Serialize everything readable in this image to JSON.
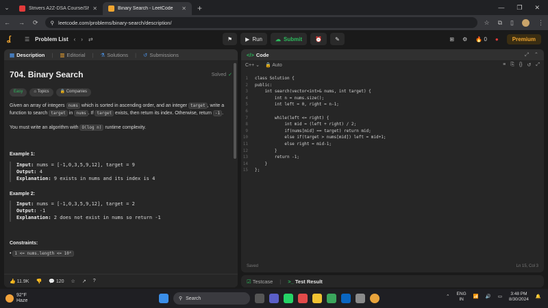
{
  "browser": {
    "tabs": [
      {
        "title": "Strivers A2Z-DSA Course/Sheet",
        "color": "#e23a3a",
        "active": false
      },
      {
        "title": "Binary Search - LeetCode",
        "color": "#f0a530",
        "active": true
      }
    ],
    "url": "leetcode.com/problems/binary-search/description/"
  },
  "header": {
    "problem_list": "Problem List",
    "run": "Run",
    "submit": "Submit",
    "streak": "0",
    "premium": "Premium"
  },
  "left": {
    "tabs": [
      "Description",
      "Editorial",
      "Solutions",
      "Submissions"
    ],
    "title": "704. Binary Search",
    "status": "Solved",
    "chips": [
      "Easy",
      "Topics",
      "Companies"
    ],
    "desc1_a": "Given an array of integers ",
    "desc1_nums": "nums",
    "desc1_b": " which is sorted in ascending order, and an integer ",
    "desc1_target": "target",
    "desc1_c": ", write a function to search ",
    "desc1_target2": "target",
    "desc1_d": " in ",
    "desc1_nums2": "nums",
    "desc1_e": ". If ",
    "desc1_target3": "target",
    "desc1_f": " exists, then return its index. Otherwise, return ",
    "desc1_neg": "-1",
    "desc1_g": ".",
    "desc2_a": "You must write an algorithm with ",
    "desc2_code": "O(log n)",
    "desc2_b": " runtime complexity.",
    "examples": [
      {
        "heading": "Example 1:",
        "input": "nums = [-1,0,3,5,9,12], target = 9",
        "output": "4",
        "explanation": "9 exists in nums and its index is 4"
      },
      {
        "heading": "Example 2:",
        "input": "nums = [-1,0,3,5,9,12], target = 2",
        "output": "-1",
        "explanation": "2 does not exist in nums so return -1"
      }
    ],
    "labels": {
      "input": "Input:",
      "output": "Output:",
      "explanation": "Explanation:"
    },
    "constraints_heading": "Constraints:",
    "constraint1": "1 <= nums.length <= 10⁴",
    "footer": {
      "likes": "11.9K",
      "comments": "120"
    }
  },
  "editor": {
    "tab": "Code",
    "language": "C++",
    "mode": "Auto",
    "lines": [
      "class Solution {",
      "public:",
      "    int search(vector<int>& nums, int target) {",
      "        int n = nums.size();",
      "        int left = 0, right = n-1;",
      "",
      "        while(left <= right) {",
      "            int mid = (left + right) / 2;",
      "            if(nums[mid] == target) return mid;",
      "            else if(target > nums[mid]) left = mid+1;",
      "            else right = mid-1;",
      "        }",
      "        return -1;",
      "    }",
      "};"
    ],
    "status_left": "Saved",
    "status_right": "Ln 15, Col 3"
  },
  "bottom": {
    "testcase": "Testcase",
    "result": "Test Result"
  },
  "taskbar": {
    "temp": "92°F",
    "weather": "Haze",
    "search": "Search",
    "lang1": "ENG",
    "lang2": "IN",
    "time": "3:48 PM",
    "date": "8/30/2024"
  }
}
